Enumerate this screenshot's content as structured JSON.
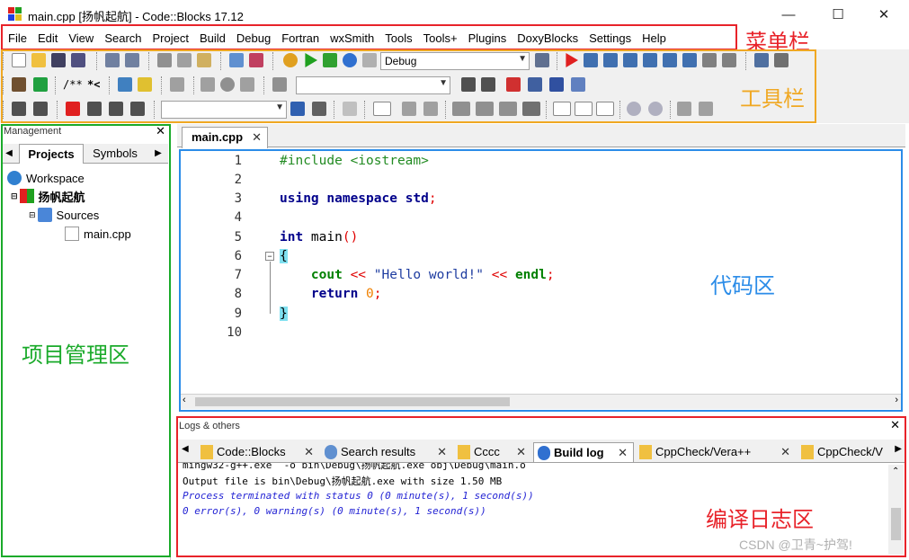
{
  "window": {
    "title": "main.cpp [扬帆起航] - Code::Blocks 17.12",
    "minimize": "—",
    "maximize": "☐",
    "close": "✕"
  },
  "menubar": {
    "items": [
      "File",
      "Edit",
      "View",
      "Search",
      "Project",
      "Build",
      "Debug",
      "Fortran",
      "wxSmith",
      "Tools",
      "Tools+",
      "Plugins",
      "DoxyBlocks",
      "Settings",
      "Help"
    ]
  },
  "toolbar": {
    "build_target": "Debug",
    "doxy_comment_1": "/**",
    "doxy_comment_2": "*<"
  },
  "management": {
    "title": "Management",
    "close": "✕",
    "tabs": [
      "Projects",
      "Symbols"
    ],
    "tree": {
      "workspace": "Workspace",
      "project": "扬帆起航",
      "folder": "Sources",
      "file": "main.cpp"
    }
  },
  "editor": {
    "tab_label": "main.cpp",
    "tab_close": "✕",
    "line_numbers": [
      "1",
      "2",
      "3",
      "4",
      "5",
      "6",
      "7",
      "8",
      "9",
      "10"
    ],
    "code": {
      "include_directive": "#include <iostream>",
      "using_kw": "using",
      "namespace_kw": "namespace",
      "std_kw": "std",
      "semicolon": ";",
      "int_kw": "int",
      "main_name": " main",
      "parens": "()",
      "open_brace": "{",
      "cout_kw": "cout",
      "shift_op": "<<",
      "hello_string": "\"Hello world!\"",
      "endl_kw": "endl",
      "return_kw": "return",
      "zero": "0",
      "close_brace": "}"
    }
  },
  "logs": {
    "title": "Logs & others",
    "close": "✕",
    "tabs": [
      {
        "label": "Code::Blocks",
        "close": "✕"
      },
      {
        "label": "Search results",
        "close": "✕"
      },
      {
        "label": "Cccc",
        "close": "✕"
      },
      {
        "label": "Build log",
        "close": "✕"
      },
      {
        "label": "CppCheck/Vera++",
        "close": "✕"
      },
      {
        "label": "CppCheck/V",
        "close": ""
      }
    ],
    "lines": [
      "mingw32-g++.exe  -o bin\\Debug\\扬帆起航.exe obj\\Debug\\main.o",
      "Output file is bin\\Debug\\扬帆起航.exe with size 1.50 MB",
      "Process terminated with status 0 (0 minute(s), 1 second(s))",
      "0 error(s), 0 warning(s) (0 minute(s), 1 second(s))"
    ]
  },
  "annotations": {
    "menu_bar": "菜单栏",
    "toolbar": "工具栏",
    "code_area": "代码区",
    "project_area": "项目管理区",
    "build_log_area": "编译日志区"
  },
  "watermark": "CSDN @卫青~护驾!",
  "colors": {
    "annotation_red": "#e8232a",
    "annotation_orange": "#f0a823",
    "annotation_green": "#1aaa2a",
    "annotation_blue": "#2b8ce8"
  }
}
